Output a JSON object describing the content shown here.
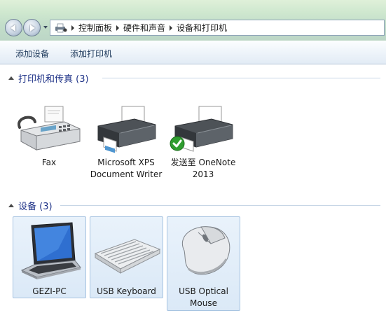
{
  "breadcrumb": {
    "items": [
      "控制面板",
      "硬件和声音",
      "设备和打印机"
    ]
  },
  "toolbar": {
    "add_device": "添加设备",
    "add_printer": "添加打印机"
  },
  "printers_group": {
    "title": "打印机和传真 (3)",
    "items": [
      {
        "label": "Fax",
        "icon": "fax-machine-icon"
      },
      {
        "label": "Microsoft XPS Document Writer",
        "icon": "printer-icon"
      },
      {
        "label": "发送至 OneNote 2013",
        "icon": "printer-icon",
        "badge": "default-checkmark-icon"
      }
    ]
  },
  "devices_group": {
    "title": "设备 (3)",
    "items": [
      {
        "label": "GEZI-PC",
        "icon": "laptop-icon"
      },
      {
        "label": "USB Keyboard",
        "icon": "keyboard-icon"
      },
      {
        "label": "USB Optical Mouse",
        "icon": "mouse-icon"
      }
    ]
  },
  "colors": {
    "group_title": "#1e3287",
    "selection_fill": "#dbe9f7",
    "selection_border": "#a8c4e1"
  }
}
